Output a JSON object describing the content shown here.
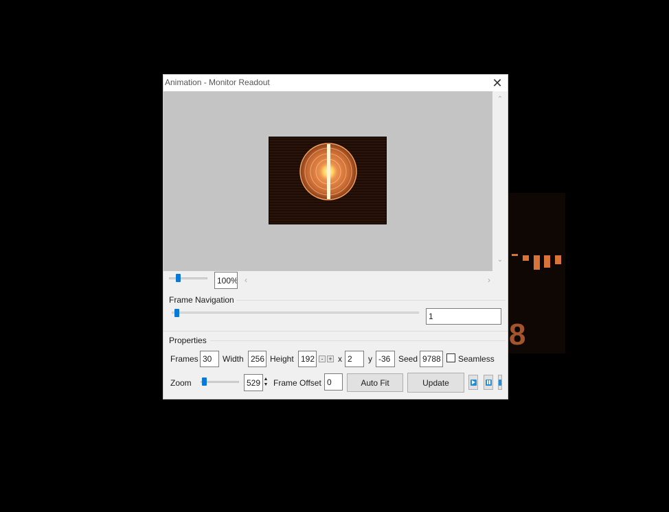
{
  "window": {
    "title": "Animation - Monitor Readout",
    "close_glyph": "✕"
  },
  "background": {
    "digit": "8",
    "bar_color": "#d8743a"
  },
  "preview": {
    "zoom_percent": "100%",
    "background_color": "#c4c4c4",
    "scroll_up": "⌃",
    "scroll_down": "⌄",
    "scroll_left": "‹",
    "scroll_right": "›"
  },
  "frame_navigation": {
    "title": "Frame Navigation",
    "current_frame": "1"
  },
  "properties": {
    "title": "Properties",
    "frames_label": "Frames",
    "frames_value": "30",
    "width_label": "Width",
    "width_value": "256",
    "height_label": "Height",
    "height_value": "192",
    "minus": "-",
    "plus": "+",
    "x_label": "x",
    "x_value": "2",
    "y_label": "y",
    "y_value": "-36",
    "seed_label": "Seed",
    "seed_value": "9788",
    "seamless_label": "Seamless",
    "seamless_checked": false,
    "zoom_label": "Zoom",
    "zoom_value": "529",
    "frame_offset_label": "Frame Offset",
    "frame_offset_value": "0",
    "auto_fit_label": "Auto Fit",
    "update_label": "Update"
  },
  "media_controls": {
    "play_icon": "play-icon",
    "pause_icon": "pause-icon",
    "accent": "#1e8fd8"
  }
}
